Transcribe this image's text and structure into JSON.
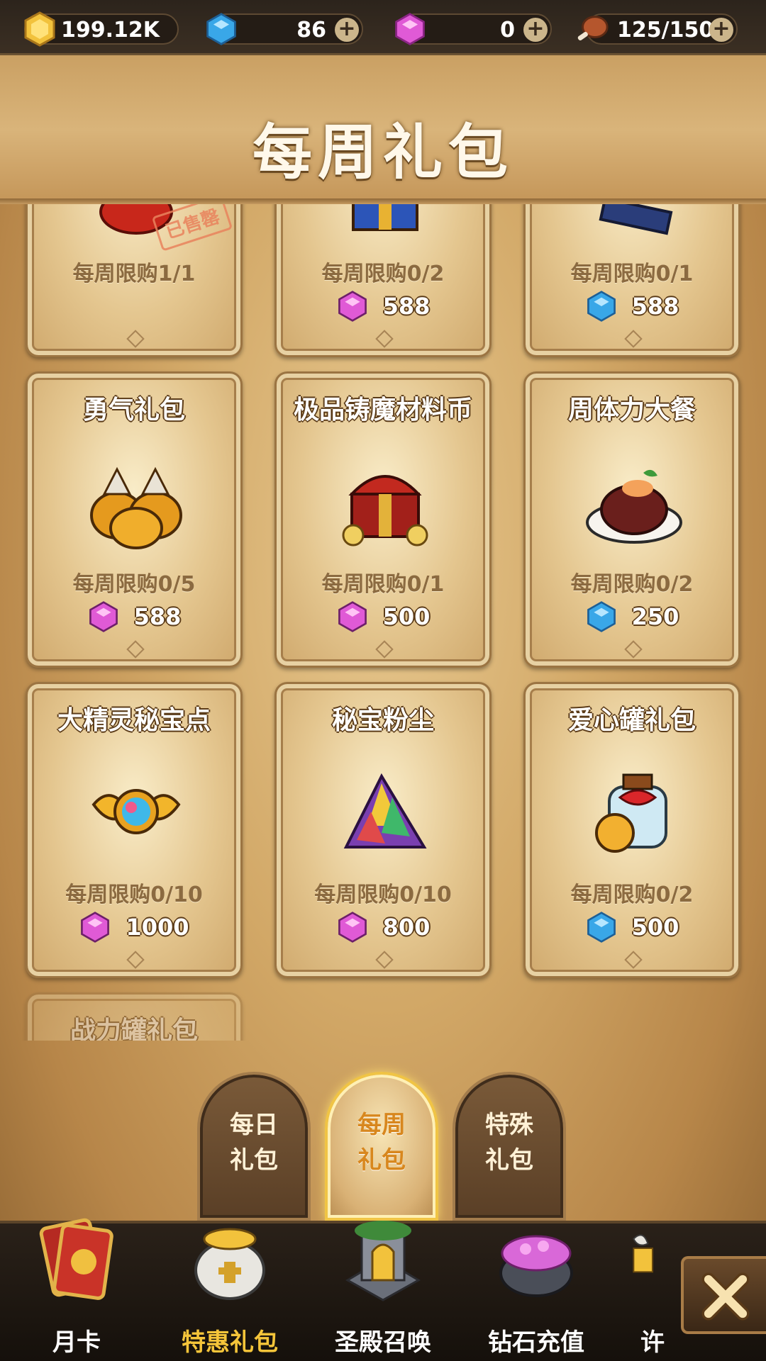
{
  "currencies": {
    "gold": "199.12K",
    "blue_gem": "86",
    "pink_gem": "0",
    "stamina": "125/150",
    "plus": "+"
  },
  "title": "每周礼包",
  "cards": [
    {
      "name": "",
      "limit": "每周限购1/1",
      "price": "",
      "currency": "none",
      "stamp": "已售罄",
      "icon": "red-pouch-icon"
    },
    {
      "name": "",
      "limit": "每周限购0/2",
      "price": "588",
      "currency": "pink",
      "icon": "treasure-box-icon"
    },
    {
      "name": "",
      "limit": "每周限购0/1",
      "price": "588",
      "currency": "blue",
      "icon": "books-icon"
    },
    {
      "name": "勇气礼包",
      "limit": "每周限购0/5",
      "price": "588",
      "currency": "pink",
      "icon": "money-bags-icon"
    },
    {
      "name": "极品铸魔材料币",
      "limit": "每周限购0/1",
      "price": "500",
      "currency": "pink",
      "icon": "treasure-chest-icon"
    },
    {
      "name": "周体力大餐",
      "limit": "每周限购0/2",
      "price": "250",
      "currency": "blue",
      "icon": "meat-dish-icon"
    },
    {
      "name": "大精灵秘宝点",
      "limit": "每周限购0/10",
      "price": "1000",
      "currency": "pink",
      "icon": "winged-gem-icon"
    },
    {
      "name": "秘宝粉尘",
      "limit": "每周限购0/10",
      "price": "800",
      "currency": "pink",
      "icon": "crystal-pile-icon"
    },
    {
      "name": "爱心罐礼包",
      "limit": "每周限购0/2",
      "price": "500",
      "currency": "blue",
      "icon": "gift-jar-icon"
    },
    {
      "name": "战力罐礼包",
      "limit": "",
      "price": "",
      "currency": "none",
      "icon": "none"
    }
  ],
  "tabs": [
    {
      "line1": "每日",
      "line2": "礼包",
      "active": false
    },
    {
      "line1": "每周",
      "line2": "礼包",
      "active": true
    },
    {
      "line1": "特殊",
      "line2": "礼包",
      "active": false
    }
  ],
  "nav": [
    {
      "label": "月卡",
      "icon": "card-icon",
      "active": false
    },
    {
      "label": "特惠礼包",
      "icon": "gift-sack-icon",
      "active": true
    },
    {
      "label": "圣殿召唤",
      "icon": "temple-icon",
      "active": false
    },
    {
      "label": "钻石充值",
      "icon": "diamond-pot-icon",
      "active": false
    },
    {
      "label": "许",
      "icon": "wish-icon",
      "active": false
    }
  ],
  "colors": {
    "pink_gem": "#e05ad6",
    "blue_gem": "#39a7e8",
    "gold": "#f2c23c",
    "active_tab": "#f0c445"
  }
}
